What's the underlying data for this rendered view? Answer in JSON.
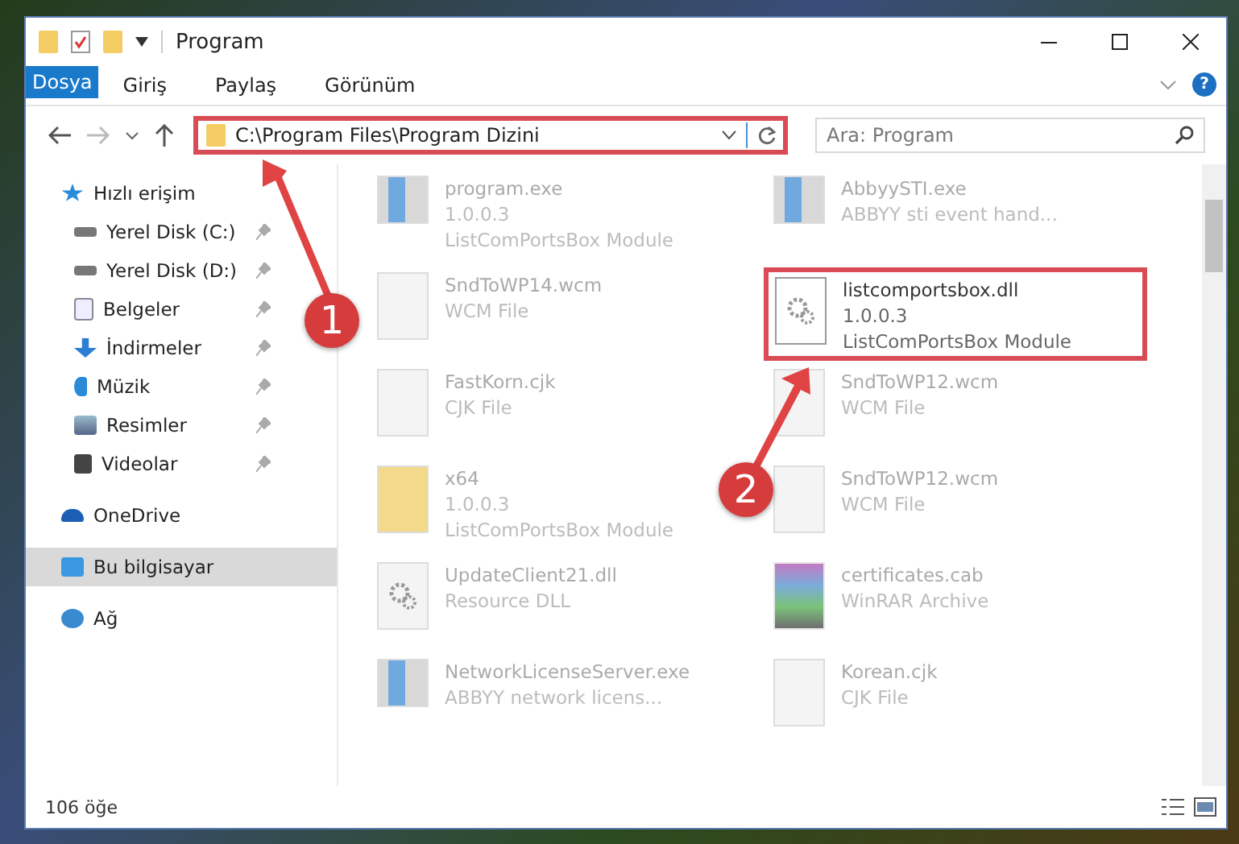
{
  "window": {
    "title": "Program"
  },
  "ribbon_tabs": [
    {
      "label": "Dosya",
      "kind": "file"
    },
    {
      "label": "Giriş",
      "kind": "tab"
    },
    {
      "label": "Paylaş",
      "kind": "tab"
    },
    {
      "label": "Görünüm",
      "kind": "tab"
    }
  ],
  "help_button": {
    "label": "?"
  },
  "address_bar": {
    "path": "C:\\Program Files\\Program Dizini"
  },
  "search": {
    "placeholder": "Ara: Program"
  },
  "sidebar": {
    "items": [
      {
        "label": "Hızlı erişim",
        "kind": "star",
        "selected": false,
        "children": [
          {
            "label": "Yerel Disk (C:)",
            "kind": "drive",
            "pinned": true
          },
          {
            "label": "Yerel Disk (D:)",
            "kind": "drive",
            "pinned": true
          },
          {
            "label": "Belgeler",
            "kind": "document",
            "pinned": true
          },
          {
            "label": "İndirmeler",
            "kind": "download",
            "pinned": true
          },
          {
            "label": "Müzik",
            "kind": "music",
            "pinned": true
          },
          {
            "label": "Resimler",
            "kind": "picture",
            "pinned": true
          },
          {
            "label": "Videolar",
            "kind": "video",
            "pinned": true
          }
        ]
      },
      {
        "label": "OneDrive",
        "kind": "cloud",
        "selected": false
      },
      {
        "label": "Bu bilgisayar",
        "kind": "computer",
        "selected": true
      },
      {
        "label": "Ağ",
        "kind": "network",
        "selected": false
      }
    ]
  },
  "files": [
    {
      "name": "program.exe",
      "details": [
        "1.0.0.3",
        "ListComPortsBox Module"
      ],
      "kind": "exe",
      "highlighted": false
    },
    {
      "name": "AbbyySTI.exe",
      "details": [
        "ABBYY sti event hand..."
      ],
      "kind": "app",
      "highlighted": false
    },
    {
      "name": "SndToWP14.wcm",
      "details": [
        "WCM File"
      ],
      "kind": "blank",
      "highlighted": false
    },
    {
      "name": "listcomportsbox.dll",
      "details": [
        "1.0.0.3",
        "ListComPortsBox Module"
      ],
      "kind": "dll",
      "highlighted": true
    },
    {
      "name": "FastKorn.cjk",
      "details": [
        "CJK File"
      ],
      "kind": "blank",
      "highlighted": false
    },
    {
      "name": "SndToWP12.wcm",
      "details": [
        "WCM File"
      ],
      "kind": "blank",
      "highlighted": false
    },
    {
      "name": "x64",
      "details": [
        "1.0.0.3",
        "ListComPortsBox Module"
      ],
      "kind": "folder",
      "highlighted": false
    },
    {
      "name": "SndToWP12.wcm",
      "details": [
        "WCM File"
      ],
      "kind": "blank",
      "highlighted": false
    },
    {
      "name": "UpdateClient21.dll",
      "details": [
        "Resource DLL"
      ],
      "kind": "dll",
      "highlighted": false
    },
    {
      "name": "certificates.cab",
      "details": [
        "WinRAR Archive"
      ],
      "kind": "archive",
      "highlighted": false
    },
    {
      "name": "NetworkLicenseServer.exe",
      "details": [
        "ABBYY network licens..."
      ],
      "kind": "app",
      "highlighted": false
    },
    {
      "name": "Korean.cjk",
      "details": [
        "CJK File"
      ],
      "kind": "blank",
      "highlighted": false
    }
  ],
  "status_bar": {
    "count": "106 öğe"
  },
  "annotations": [
    {
      "number": "1"
    },
    {
      "number": "2"
    }
  ]
}
